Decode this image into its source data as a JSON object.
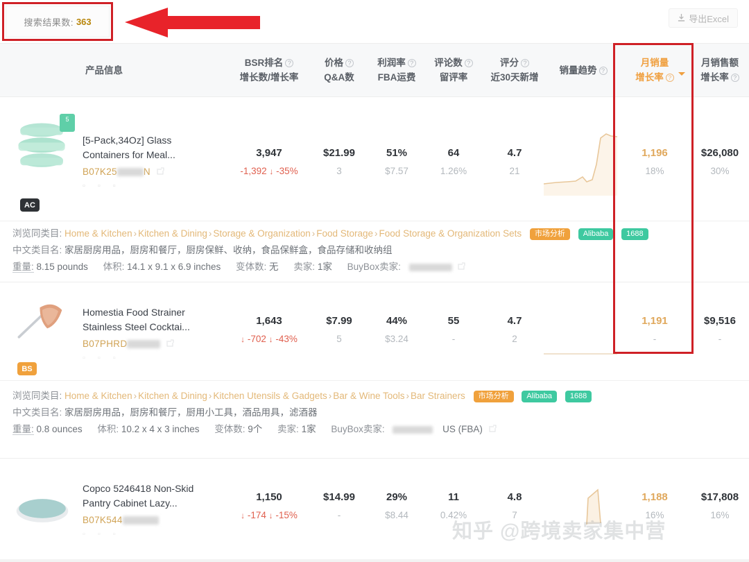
{
  "topbar": {
    "result_label": "搜索结果数:",
    "result_value": "363",
    "export_label": "导出Excel",
    "export_icon": "download-icon"
  },
  "columns": {
    "product": "产品信息",
    "bsr_l1": "BSR排名",
    "bsr_l2": "增长数/增长率",
    "price_l1": "价格",
    "price_l2": "Q&A数",
    "profit_l1": "利润率",
    "profit_l2": "FBA运费",
    "reviews_l1": "评论数",
    "reviews_l2": "留评率",
    "rating_l1": "评分",
    "rating_l2": "近30天新增",
    "trend_l1": "销量趋势",
    "sales_l1": "月销量",
    "sales_l2": "增长率",
    "revenue_l1": "月销售额",
    "revenue_l2": "增长率"
  },
  "rows": [
    {
      "title_line1": "[5-Pack,34Oz] Glass",
      "title_line2": "Containers for Meal...",
      "asin_prefix": "B07K25",
      "asin_suffix": "N",
      "badge": "AC",
      "badge_type": "ac",
      "bsr": "3,947",
      "bsr_delta": "-1,392",
      "bsr_rate": "-35%",
      "price": "$21.99",
      "qa": "3",
      "profit": "51%",
      "fba": "$7.57",
      "reviews": "64",
      "review_rate": "1.26%",
      "rating": "4.7",
      "rating_new": "21",
      "sales": "1,196",
      "sales_growth": "18%",
      "revenue": "$26,080",
      "revenue_growth": "30%",
      "detail": {
        "cat_label": "浏览同类目:",
        "cat_path": [
          "Home & Kitchen",
          "Kitchen & Dining",
          "Storage & Organization",
          "Food Storage",
          "Food Storage & Organization Sets"
        ],
        "cn_label": "中文类目名:",
        "cn_path": "家居厨房用品，厨房和餐厅，厨房保鲜、收纳，食品保鲜盒，食品存储和收纳组",
        "weight_label": "重量:",
        "weight": "8.15 pounds",
        "volume_label": "体积:",
        "volume": "14.1 x 9.1 x 6.9 inches",
        "variant_label": "变体数:",
        "variant": "无",
        "seller_label": "卖家:",
        "seller": "1家",
        "buybox_label": "BuyBox卖家:",
        "buybox": "",
        "tags": [
          "市场分析",
          "Alibaba",
          "1688"
        ]
      }
    },
    {
      "title_line1": "Homestia Food Strainer",
      "title_line2": "Stainless Steel Cocktai...",
      "asin_prefix": "B07PHRD",
      "asin_suffix": "",
      "badge": "BS",
      "badge_type": "bs",
      "bsr": "1,643",
      "bsr_delta": "-702",
      "bsr_rate": "-43%",
      "price": "$7.99",
      "qa": "5",
      "profit": "44%",
      "fba": "$3.24",
      "reviews": "55",
      "review_rate": "-",
      "rating": "4.7",
      "rating_new": "2",
      "sales": "1,191",
      "sales_growth": "-",
      "revenue": "$9,516",
      "revenue_growth": "-",
      "detail": {
        "cat_label": "浏览同类目:",
        "cat_path": [
          "Home & Kitchen",
          "Kitchen & Dining",
          "Kitchen Utensils & Gadgets",
          "Bar & Wine Tools",
          "Bar Strainers"
        ],
        "cn_label": "中文类目名:",
        "cn_path": "家居厨房用品，厨房和餐厅，厨用小工具，酒品用具，滤酒器",
        "weight_label": "重量:",
        "weight": "0.8 ounces",
        "volume_label": "体积:",
        "volume": "10.2 x 4 x 3 inches",
        "variant_label": "变体数:",
        "variant": "9个",
        "seller_label": "卖家:",
        "seller": "1家",
        "buybox_label": "BuyBox卖家:",
        "buybox": "US (FBA)",
        "tags": [
          "市场分析",
          "Alibaba",
          "1688"
        ]
      }
    },
    {
      "title_line1": "Copco 5246418 Non-Skid",
      "title_line2": "Pantry Cabinet Lazy...",
      "asin_prefix": "B07K544",
      "asin_suffix": "",
      "badge": "",
      "badge_type": "",
      "bsr": "1,150",
      "bsr_delta": "-174",
      "bsr_rate": "-15%",
      "price": "$14.99",
      "qa": "-",
      "profit": "29%",
      "fba": "$8.44",
      "reviews": "11",
      "review_rate": "0.42%",
      "rating": "4.8",
      "rating_new": "7",
      "sales": "1,188",
      "sales_growth": "16%",
      "revenue": "$17,808",
      "revenue_growth": "16%",
      "detail": null
    }
  ],
  "annotation": {
    "color": "#cf2026",
    "arrow_name": "red-arrow-pointing-left",
    "box_name": "red-highlight-box"
  },
  "watermark": "知乎 @跨境卖家集中营"
}
